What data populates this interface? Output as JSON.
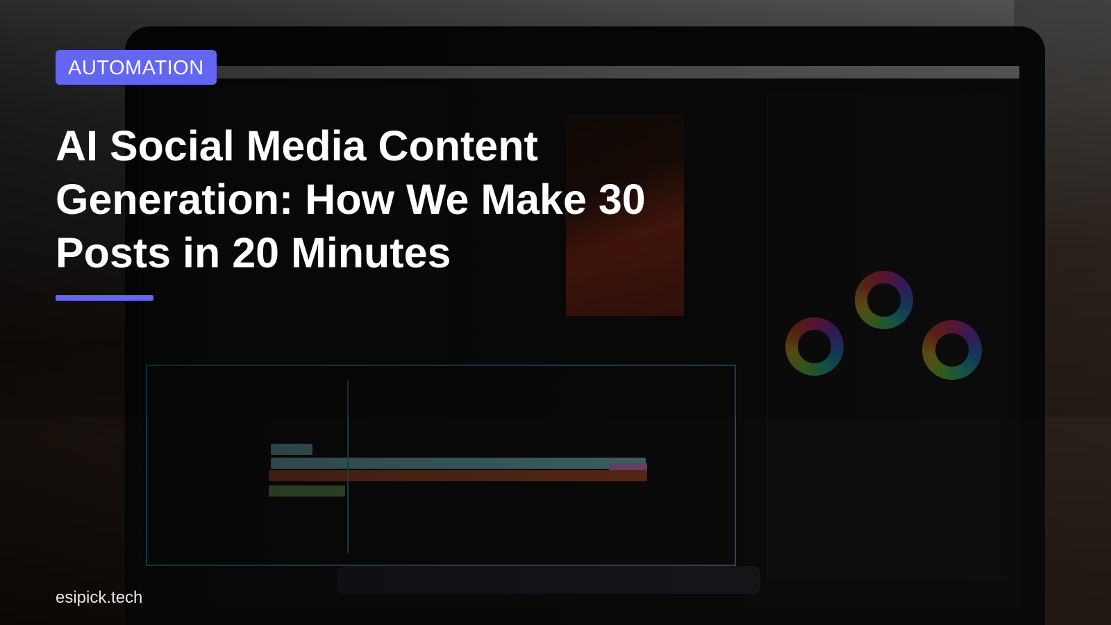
{
  "badge": {
    "label": "AUTOMATION",
    "color": "#6366f1"
  },
  "headline": {
    "text": "AI Social Media Content Generation: How We Make 30 Posts in 20 Minutes"
  },
  "accent": {
    "color": "#6366f1"
  },
  "footer": {
    "site": "esipick.tech"
  },
  "background": {
    "description_icon": "video-editor-photo"
  }
}
